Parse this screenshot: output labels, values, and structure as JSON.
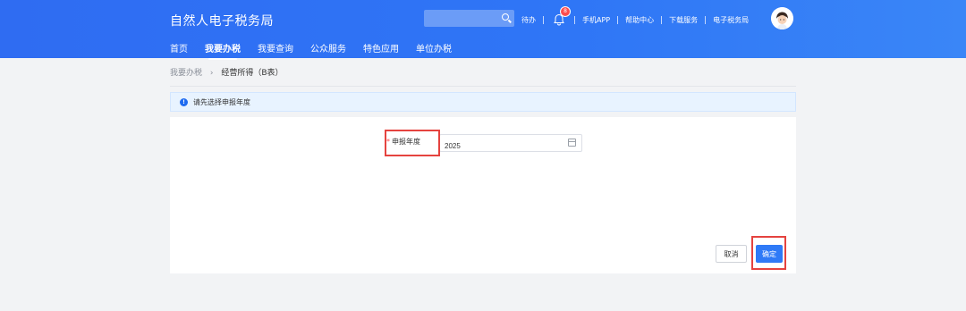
{
  "header": {
    "title": "自然人电子税务局",
    "search_placeholder": "",
    "todo": "待办",
    "bell_badge": "8",
    "mobile_app": "手机APP",
    "help_center": "帮助中心",
    "download": "下载服务",
    "e_tax_bureau": "电子税务局"
  },
  "nav": {
    "items": [
      {
        "label": "首页"
      },
      {
        "label": "我要办税"
      },
      {
        "label": "我要查询"
      },
      {
        "label": "公众服务"
      },
      {
        "label": "特色应用"
      },
      {
        "label": "单位办税"
      }
    ]
  },
  "breadcrumb": {
    "parent": "我要办税",
    "separator": "›",
    "current": "经营所得（B表）"
  },
  "notice": {
    "text": "请先选择申报年度",
    "icon": "info-icon"
  },
  "form": {
    "required_mark": "*",
    "year_label": "申报年度",
    "year_value": "2025",
    "icon": "calendar-icon"
  },
  "actions": {
    "cancel": "取消",
    "confirm": "确定"
  },
  "colors": {
    "brand": "#2f6cf2",
    "highlight": "#e5433f",
    "primary_button": "#2f7af7"
  }
}
